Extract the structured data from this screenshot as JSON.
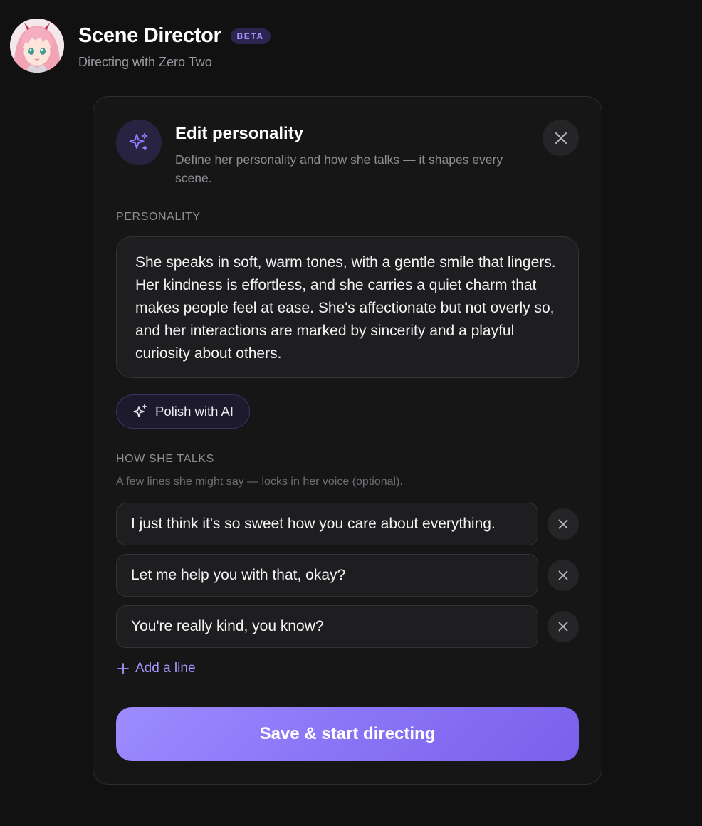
{
  "header": {
    "app_title": "Scene Director",
    "badge": "BETA",
    "subtitle": "Directing with Zero Two"
  },
  "modal": {
    "title": "Edit personality",
    "description": "Define her personality and how she talks — it shapes every scene.",
    "personality_label": "PERSONALITY",
    "personality_text": "She speaks in soft, warm tones, with a gentle smile that lingers. Her kindness is effortless, and she carries a quiet charm that makes people feel at ease. She's affectionate but not overly so, and her interactions are marked by sincerity and a playful curiosity about others.",
    "polish_label": "Polish with AI",
    "talk_label": "HOW SHE TALKS",
    "talk_hint": "A few lines she might say — locks in her voice (optional).",
    "lines": [
      "I just think it's so sweet how you care about everything.",
      "Let me help you with that, okay?",
      "You're really kind, you know?"
    ],
    "add_line_label": "Add a line",
    "save_label": "Save & start directing"
  },
  "colors": {
    "background": "#121112",
    "card": "#171617",
    "accent": "#a895ff",
    "button_gradient_start": "#9d8cff",
    "button_gradient_end": "#7a60ea"
  },
  "icons": {
    "avatar": "anime-avatar",
    "modal_icon": "sparkles-icon",
    "close": "close-icon",
    "polish": "sparkles-icon",
    "remove": "close-icon",
    "add": "plus-icon"
  }
}
